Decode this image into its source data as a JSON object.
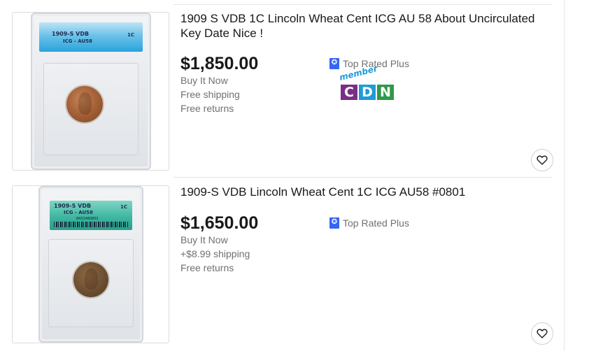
{
  "listings": [
    {
      "title": "1909 S VDB 1C Lincoln Wheat Cent ICG AU 58 About Uncirculated Key Date Nice !",
      "price": "$1,850.00",
      "buy_format": "Buy It Now",
      "shipping": "Free shipping",
      "returns": "Free returns",
      "badge": "Top Rated Plus",
      "badge_icon": "top-rated-plus-icon",
      "slab_label": {
        "line1": "1909-S VDB",
        "line2": "ICG - AU58",
        "denomination": "1C"
      },
      "member_logo": {
        "member_text": "member",
        "letters": [
          "C",
          "D",
          "N"
        ],
        "colors": [
          "#7a2f86",
          "#1f9bd7",
          "#2e9a4a"
        ]
      },
      "watch_icon": "heart-icon"
    },
    {
      "title": "1909-S VDB Lincoln Wheat Cent 1C ICG AU58 #0801",
      "price": "$1,650.00",
      "buy_format": "Buy It Now",
      "shipping": "+$8.99 shipping",
      "returns": "Free returns",
      "badge": "Top Rated Plus",
      "badge_icon": "top-rated-plus-icon",
      "slab_label": {
        "line1": "1909-S VDB",
        "line2": "ICG - AU58",
        "denomination": "1C",
        "serial": "8432480801"
      },
      "watch_icon": "heart-icon"
    }
  ],
  "colors": {
    "text": "#191919",
    "muted": "#707070",
    "badge_blue": "#3665f3",
    "divider": "#e5e5e5"
  }
}
